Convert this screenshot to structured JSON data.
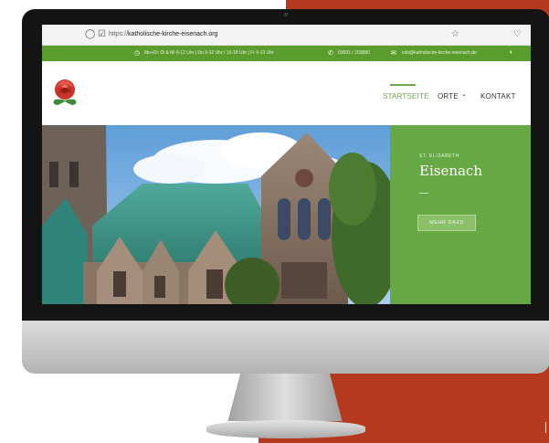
{
  "colors": {
    "background_red": "#b5391f",
    "brand_green": "#5b9d2d",
    "panel_green": "#66a843",
    "accent_green": "#6aa84f"
  },
  "browser": {
    "url_prefix": "https://",
    "url_domain": "katholische-kirche-eisenach.org",
    "icons": [
      "shield-icon",
      "lock-icon",
      "star-icon",
      "pocket-icon"
    ]
  },
  "info_bar": {
    "hours": "Mo+Di: Di & Mi 9-12 Uhr | Do 9-12 Uhr / 15-18 Uhr | Fr 9-13 Uhr",
    "phone": "03691 / 203880",
    "email": "info@katholische-kirche-eisenach.de"
  },
  "nav": {
    "items": [
      {
        "label": "STARTSEITE",
        "active": true
      },
      {
        "label": "ORTE",
        "caret": "⌄"
      },
      {
        "label": "KONTAKT"
      }
    ]
  },
  "hero": {
    "kicker": "ST. ELISABETH",
    "title": "Eisenach",
    "button": "MEHR DAZU"
  }
}
